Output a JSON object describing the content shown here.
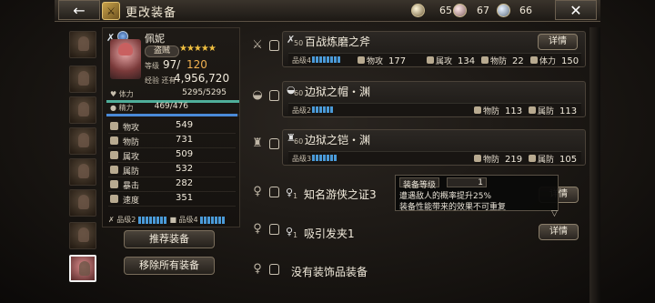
{
  "header": {
    "back_label": "←",
    "title": "更改装备",
    "close_label": "✕",
    "currencies": [
      {
        "icon": "gem-white-icon",
        "label": "",
        "value": "65"
      },
      {
        "icon": "gem-pink-icon",
        "label": "",
        "value": "67"
      },
      {
        "icon": "gem-blue-icon",
        "label": "",
        "value": "66"
      }
    ]
  },
  "character": {
    "name": "佩妮",
    "job": "盗贼",
    "stars": "★★★★★",
    "level_label": "等级",
    "level": "97",
    "level_sep": "/",
    "level_max": "120",
    "exp_label": "经验 还有",
    "exp": "4,956,720",
    "hp_label": "体力",
    "hp": "5295/5295",
    "hp_fraction": 1.0,
    "mp_label": "精力",
    "mp": "469/476",
    "mp_fraction": 0.985,
    "stats": [
      {
        "label": "物攻",
        "value": "549"
      },
      {
        "label": "物防",
        "value": "731"
      },
      {
        "label": "属攻",
        "value": "509"
      },
      {
        "label": "属防",
        "value": "532"
      },
      {
        "label": "暴击",
        "value": "282"
      },
      {
        "label": "速度",
        "value": "351"
      }
    ],
    "grade_a": "品级2",
    "grade_b": "品级4"
  },
  "buttons": {
    "recommend": "推荐装备",
    "remove_all": "移除所有装备"
  },
  "equipment": [
    {
      "level": "50",
      "name": "百战炼磨之斧",
      "detail": "详情",
      "grade": "品级4",
      "stats": [
        {
          "label": "物攻",
          "value": "177"
        },
        {
          "label": "属攻",
          "value": "134"
        },
        {
          "label": "物防",
          "value": "22"
        },
        {
          "label": "体力",
          "value": "150"
        }
      ]
    },
    {
      "level": "60",
      "name": "边狱之帽・渊",
      "detail": "",
      "grade": "品级2",
      "stats": [
        {
          "label": "物防",
          "value": "113"
        },
        {
          "label": "属防",
          "value": "113"
        }
      ]
    },
    {
      "level": "60",
      "name": "边狱之铠・渊",
      "detail": "",
      "grade": "品级3",
      "stats": [
        {
          "label": "物防",
          "value": "219"
        },
        {
          "label": "属防",
          "value": "105"
        }
      ]
    },
    {
      "level": "1",
      "name": "知名游侠之证3",
      "detail": "详情"
    },
    {
      "level": "1",
      "name": "吸引发夹1",
      "detail": "详情"
    },
    {
      "level": "",
      "name": "没有装饰品装备",
      "detail": ""
    }
  ],
  "tooltip": {
    "head": "装备等级",
    "value": "1",
    "line1": "遭遇敌人的概率提升25%",
    "line2": "装备性能带来的效果不可重复"
  }
}
